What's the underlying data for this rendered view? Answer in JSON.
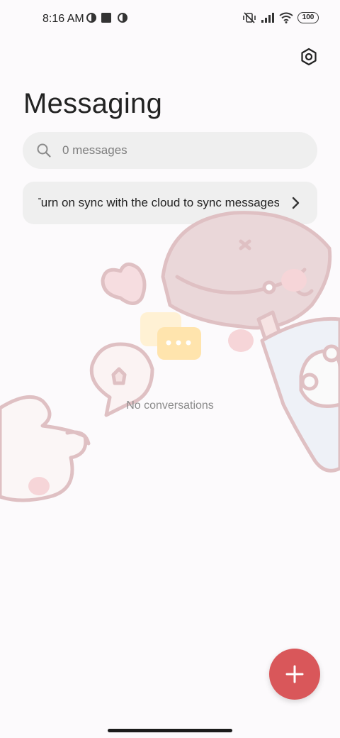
{
  "status_bar": {
    "time": "8:16 AM",
    "battery": "100",
    "icons": [
      "theme-icon",
      "square-icon",
      "theme-icon",
      "vibrate-off-icon",
      "signal-icon",
      "wifi-icon",
      "battery-icon"
    ]
  },
  "header": {
    "title": "Messaging",
    "settings_icon": "settings-hexagon-icon"
  },
  "search": {
    "placeholder": "0 messages",
    "icon": "search-icon"
  },
  "sync_banner": {
    "text": "Turn on sync with the cloud to sync messages",
    "icon": "chevron-right-icon"
  },
  "empty_state": {
    "text": "No conversations",
    "icon": "chat-bubbles-icon"
  },
  "fab": {
    "icon": "plus-icon"
  },
  "colors": {
    "accent": "#d9575a",
    "background": "#fcfafc",
    "surface": "#efefef",
    "empty_icon": "#ffd36b"
  }
}
